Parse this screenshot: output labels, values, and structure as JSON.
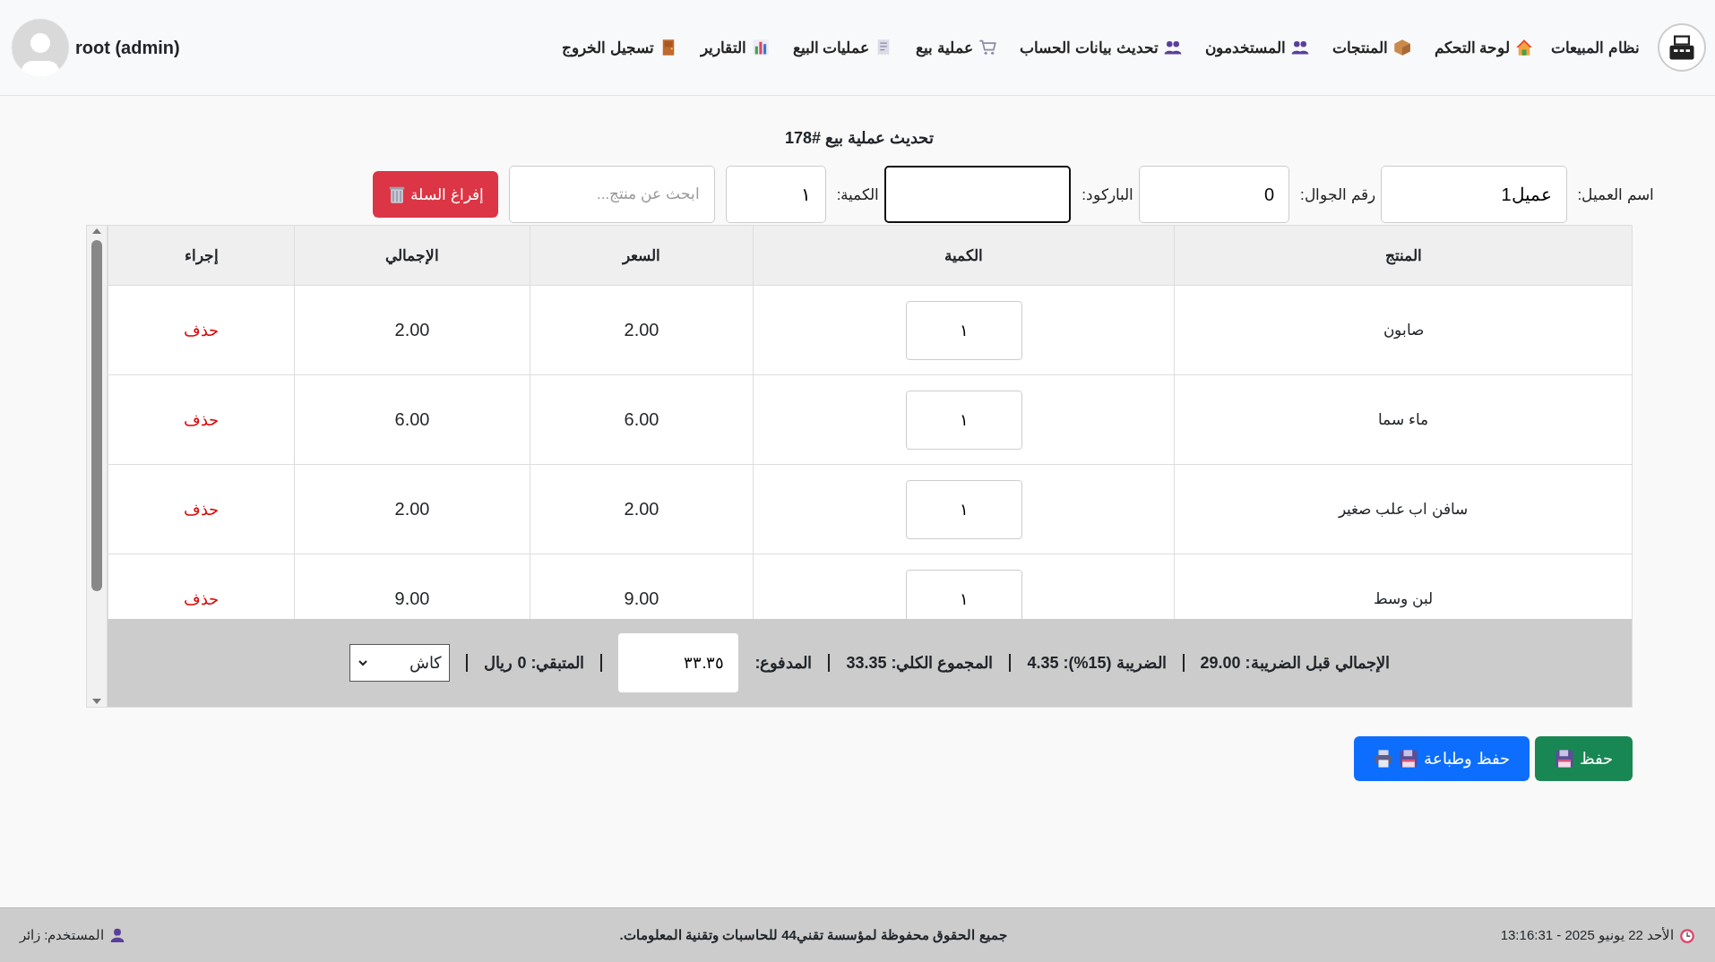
{
  "header": {
    "brand": "نظام المبيعات",
    "nav": [
      {
        "label": "لوحة التحكم"
      },
      {
        "label": "المنتجات"
      },
      {
        "label": "المستخدمون"
      },
      {
        "label": "تحديث بيانات الحساب"
      },
      {
        "label": "عملية بيع"
      },
      {
        "label": "عمليات البيع"
      },
      {
        "label": "التقارير"
      },
      {
        "label": "تسجيل الخروج"
      }
    ],
    "user": "root (admin)"
  },
  "title": "تحديث عملية بيع #178",
  "form": {
    "fields": [
      {
        "label": "اسم العميل:",
        "value": "عميل1",
        "focused": false
      },
      {
        "label": "رقم الجوال:",
        "value": "0",
        "focused": false
      },
      {
        "label": "الباركود:",
        "focused": true
      },
      {
        "label": "الكمية:",
        "value": "١",
        "focused": false
      }
    ],
    "search": {
      "placeholder": "ابحث عن منتج..."
    },
    "clear_button": "إفراغ السلة"
  },
  "table": {
    "columns": [
      "المنتج",
      "الكمية",
      "السعر",
      "الإجمالي",
      "إجراء"
    ],
    "rows": [
      {
        "product": "صابون",
        "quantity": "١",
        "price": "2.00",
        "total": "2.00",
        "action": "حذف"
      },
      {
        "product": "ماء سما",
        "quantity": "١",
        "price": "6.00",
        "total": "6.00",
        "action": "حذف"
      },
      {
        "product": "سافن اب علب صغير",
        "quantity": "١",
        "price": "2.00",
        "total": "2.00",
        "action": "حذف"
      },
      {
        "product": "لبن وسط",
        "quantity": "١",
        "price": "9.00",
        "total": "9.00",
        "action": "حذف"
      }
    ],
    "summary": {
      "subtotal": "الإجمالي قبل الضريبة: 29.00",
      "tax": "الضريبة (15%): 4.35",
      "grand_total": "المجموع الكلي: 33.35",
      "paid_label": "المدفوع:",
      "paid_value": "٣٣.٣٥",
      "remaining": "المتبقي: 0 ريال",
      "payment_method": "كاش"
    }
  },
  "buttons": [
    {
      "label": "حفظ",
      "kind": "save"
    },
    {
      "label": "حفظ وطباعة",
      "kind": "print"
    }
  ],
  "footer": {
    "datetime": "الأحد 22 يونيو 2025 - 13:16:31",
    "copyright": "جميع الحقوق محفوظة لمؤسسة تقني44 للحاسبات وتقنية المعلومات.",
    "user": "المستخدم: زائر"
  }
}
